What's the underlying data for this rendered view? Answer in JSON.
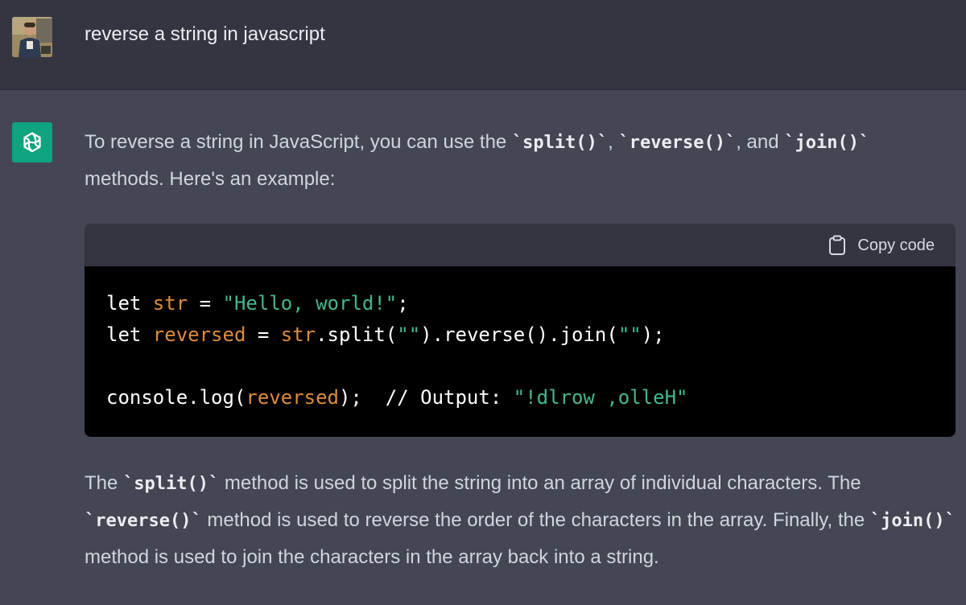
{
  "user_message": {
    "text": "reverse a string in javascript"
  },
  "assistant_message": {
    "para1": {
      "t1": "To reverse a string in JavaScript, you can use the ",
      "c1": "`split()`",
      "t2": ", ",
      "c2": "`reverse()`",
      "t3": ", and ",
      "c3": "`join()`",
      "t4": "methods. Here's an example:"
    },
    "code_block": {
      "copy_label": "Copy code",
      "line1": {
        "kw": "let ",
        "var": "str",
        "op": " = ",
        "str": "\"Hello, world!\"",
        "end": ";"
      },
      "line2": {
        "kw": "let ",
        "var": "reversed",
        "op": " = ",
        "obj": "str",
        "rest": ".split(",
        "s1": "\"\"",
        "mid": ").reverse().join(",
        "s2": "\"\"",
        "end": ");"
      },
      "line4": {
        "fn": "console.log(",
        "arg": "reversed",
        "close": ");  // Output: ",
        "str": "\"!dlrow ,olleH\""
      }
    },
    "para2": {
      "t1": "The ",
      "c1": "`split()`",
      "t2": " method is used to split the string into an array of individual characters. The ",
      "c2": "`reverse()`",
      "t3": " method is used to reverse the order of the characters in the array. Finally, the ",
      "c3": "`join()`",
      "t4": " method is used to join the characters in the array back into a string."
    }
  },
  "colors": {
    "user_bg": "#343541",
    "assistant_bg": "#444654",
    "bot_avatar": "#10a37f",
    "code_bg": "#000000",
    "code_var": "#df8d3e",
    "code_string": "#44b88e"
  },
  "icons": {
    "user_avatar": "user-photo-avatar",
    "bot_avatar": "openai-logo-icon",
    "copy": "clipboard-icon"
  }
}
